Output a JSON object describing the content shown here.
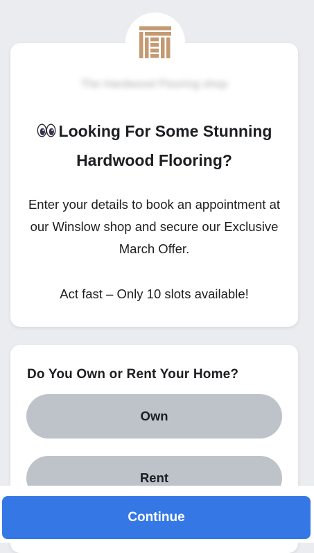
{
  "intro": {
    "logo_icon": "parquet-floor-logo-icon",
    "business_name": "The Hardwood Flooring shop",
    "emoji_icon": "eyes-emoji-icon",
    "headline": "Looking For Some Stunning Hardwood Flooring?",
    "description": "Enter your details to book an appointment at our Winslow shop and secure our Exclusive March Offer.",
    "urgency": "Act fast – Only 10 slots available!"
  },
  "question": {
    "label": "Do You Own or Rent Your Home?",
    "options": [
      {
        "label": "Own"
      },
      {
        "label": "Rent"
      }
    ]
  },
  "footer": {
    "continue_label": "Continue"
  },
  "colors": {
    "background": "#ebecf0",
    "card": "#ffffff",
    "option_fill": "#bec3c9",
    "primary_button": "#3578e5",
    "logo_wood": "#c49a72"
  }
}
